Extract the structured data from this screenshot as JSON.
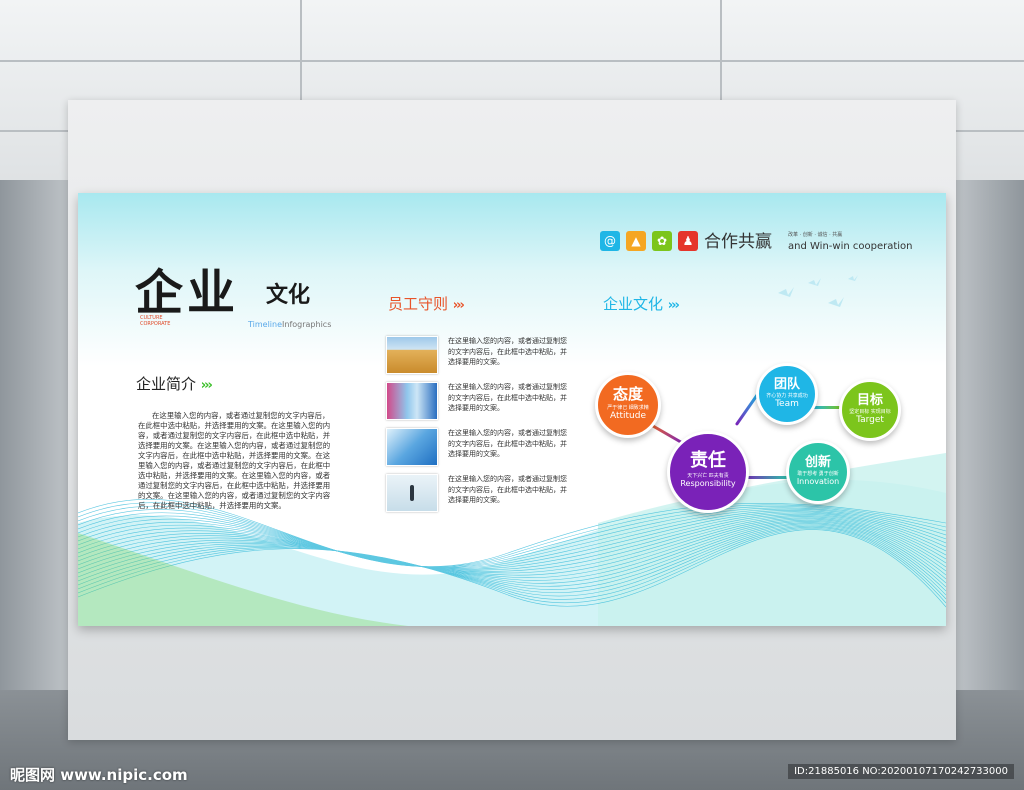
{
  "board": {
    "title_big": "企业",
    "title_small": "文化",
    "title_en_lines": [
      "CULTURE",
      "CORPORATE"
    ],
    "timeline": {
      "part1": "Time",
      "part2": "line",
      "part3": "Infographics"
    }
  },
  "intro": {
    "heading": "企业简介",
    "arrows": "›››",
    "body": "在这里输入您的内容，或者通过复制您的文字内容后，在此框中选中粘贴，并选择要用的文案。在这里输入您的内容，或者通过复制您的文字内容后，在此框中选中粘贴，并选择要用的文案。在这里输入您的内容，或者通过复制您的文字内容后，在此框中选中粘贴，并选择要用的文案。在这里输入您的内容，或者通过复制您的文字内容后，在此框中选中粘贴，并选择要用的文案。在这里输入您的内容，或者通过复制您的文字内容后，在此框中选中粘贴，并选择要用的文案。在这里输入您的内容，或者通过复制您的文字内容后，在此框中选中粘贴，并选择要用的文案。"
  },
  "rules": {
    "heading": "员工守则",
    "arrows": "›››",
    "items": [
      {
        "text": "在这里输入您的内容，或者通过复制您的文字内容后，在此框中选中粘贴，并选择要用的文案。"
      },
      {
        "text": "在这里输入您的内容，或者通过复制您的文字内容后，在此框中选中粘贴，并选择要用的文案。"
      },
      {
        "text": "在这里输入您的内容，或者通过复制您的文字内容后，在此框中选中粘贴，并选择要用的文案。"
      },
      {
        "text": "在这里输入您的内容，或者通过复制您的文字内容后，在此框中选中粘贴，并选择要用的文案。"
      }
    ]
  },
  "culture": {
    "heading": "企业文化",
    "arrows": "›››",
    "nodes": [
      {
        "cn": "态度",
        "sub": "严于律己  細致求精",
        "en": "Attitude",
        "color": "#f26a21"
      },
      {
        "cn": "团队",
        "sub": "齐心协力  共享成功",
        "en": "Team",
        "color": "#1fb6e6"
      },
      {
        "cn": "目标",
        "sub": "坚定目标  实现目标",
        "en": "Target",
        "color": "#7cc51c"
      },
      {
        "cn": "责任",
        "sub": "天下兴亡  匹夫有责",
        "en": "Responsibility",
        "color": "#7a22b8"
      },
      {
        "cn": "创新",
        "sub": "敢于想考  勇于创新",
        "en": "Innovation",
        "color": "#2cc4a8"
      }
    ]
  },
  "cooperation": {
    "title": "合作共赢",
    "tagline": "改革 · 创新 · 诚信 · 共赢",
    "english": "and Win-win  cooperation",
    "icons": [
      {
        "name": "at-icon",
        "glyph": "@",
        "color": "#1fb6e6"
      },
      {
        "name": "chart-icon",
        "glyph": "▲",
        "color": "#f5a623"
      },
      {
        "name": "gear-icon",
        "glyph": "✿",
        "color": "#7cc51c"
      },
      {
        "name": "user-icon",
        "glyph": "♟",
        "color": "#e5352b"
      }
    ]
  },
  "watermark": {
    "left": "昵图网 www.nipic.com",
    "right": "ID:21885016 NO:20200107170242733000"
  }
}
